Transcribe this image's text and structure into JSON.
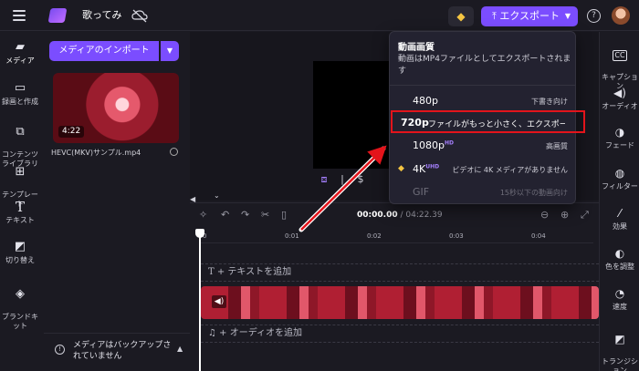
{
  "project": {
    "title": "歌ってみ"
  },
  "top": {
    "export_label": "エクスポート"
  },
  "left_nav": [
    {
      "label": "メディア",
      "icon": "folder-icon"
    },
    {
      "label": "録画と作成",
      "icon": "camera-icon"
    },
    {
      "label": "コンテンツ\nライブラリ",
      "icon": "library-icon"
    },
    {
      "label": "テンプレー\nト",
      "icon": "grid-icon"
    },
    {
      "label": "テキスト",
      "icon": "text-icon"
    },
    {
      "label": "切り替え",
      "icon": "transition-icon"
    },
    {
      "label": "ブランドキ\nット",
      "icon": "brand-icon"
    }
  ],
  "media": {
    "import_label": "メディアのインポート",
    "clip_duration": "4:22",
    "file_name": "HEVC(MKV)サンプル.mp4",
    "backup_notice": "メディアはバックアップされていません"
  },
  "timeline": {
    "current_time": "00:00.00",
    "total_time": "/ 04:22.39",
    "ticks": [
      "0",
      "0:01",
      "0:02",
      "0:03",
      "0:04"
    ],
    "add_text": "+ テキストを追加",
    "add_audio": "+ オーディオを追加"
  },
  "right_nav": [
    {
      "label": "キャプショ\nン",
      "icon": "cc-icon"
    },
    {
      "label": "オーディオ",
      "icon": "speaker-icon"
    },
    {
      "label": "フェード",
      "icon": "fade-icon"
    },
    {
      "label": "フィルター",
      "icon": "filter-icon"
    },
    {
      "label": "効果",
      "icon": "wand-icon"
    },
    {
      "label": "色を調整",
      "icon": "color-icon"
    },
    {
      "label": "速度",
      "icon": "speed-icon"
    },
    {
      "label": "トランジシ\nョン",
      "icon": "transition-icon"
    }
  ],
  "export_menu": {
    "title": "動画画質",
    "description": "動画はMP4ファイルとしてエクスポートされます",
    "options": [
      {
        "res": "480p",
        "badge": "",
        "desc": "下書き向け",
        "state": "normal"
      },
      {
        "res": "720p",
        "badge": "",
        "desc": "ファイルがもっと小さく、エクスポートがよ",
        "state": "selected"
      },
      {
        "res": "1080p",
        "badge": "HD",
        "desc": "高画質",
        "state": "normal"
      },
      {
        "res": "4K",
        "badge": "UHD",
        "desc": "ビデオに 4K メディアがありません",
        "state": "premium"
      },
      {
        "res": "GIF",
        "badge": "",
        "desc": "15秒以下の動画向け",
        "state": "disabled"
      }
    ]
  },
  "colors": {
    "accent": "#7b4dff",
    "annotation": "#e3141b",
    "premium": "#f5c542"
  }
}
